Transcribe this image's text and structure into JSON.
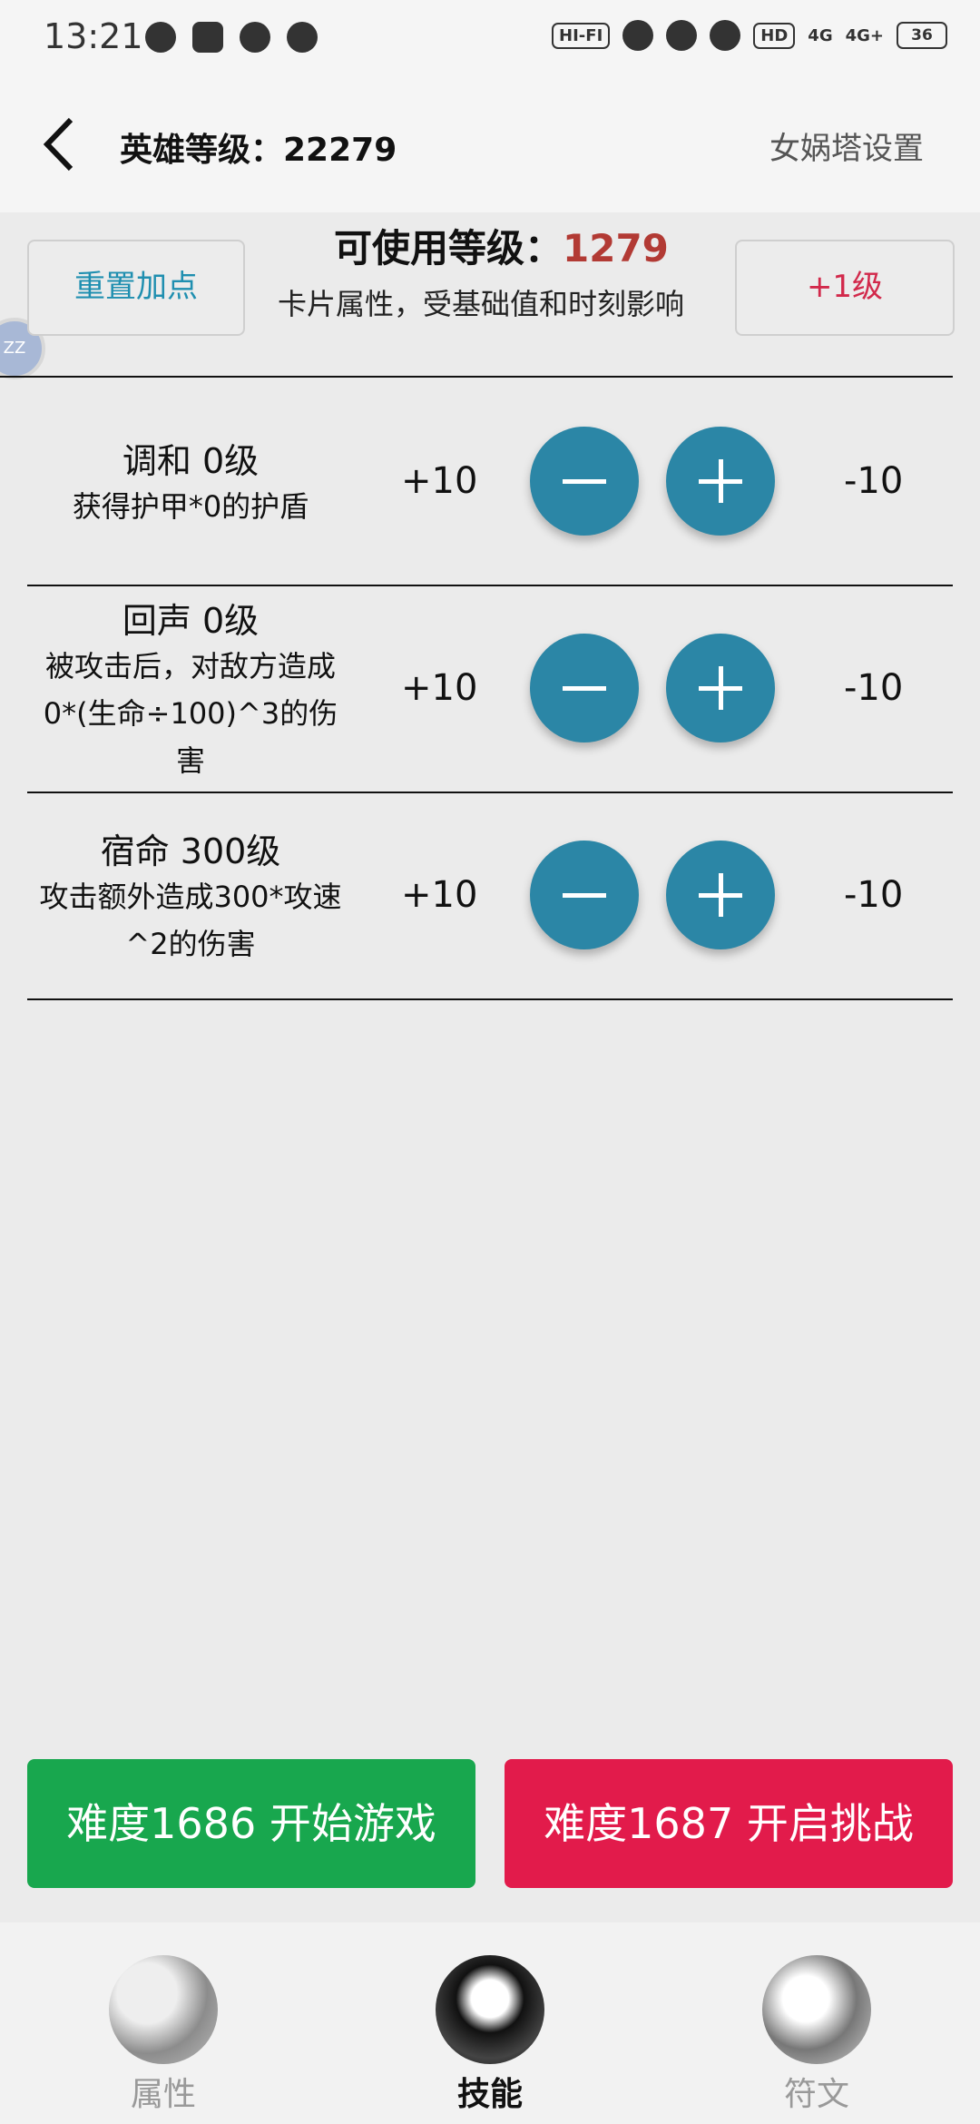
{
  "status_bar": {
    "time": "13:21",
    "hifi": "HI-FI",
    "hd": "HD",
    "net1": "4G",
    "net2": "4G+",
    "battery": "36"
  },
  "header": {
    "title": "英雄等级：22279",
    "settings": "女娲塔设置"
  },
  "top": {
    "reset_label": "重置加点",
    "avail_label": "可使用等级：",
    "avail_value": "1279",
    "description": "卡片属性，受基础值和时刻影响",
    "plus_level_label": "+1级"
  },
  "float_bubble": "ZZ",
  "skills": [
    {
      "name": "调和 0级",
      "desc": "获得护甲*0的护盾",
      "inc": "+10",
      "dec": "-10"
    },
    {
      "name": "回声 0级",
      "desc": "被攻击后，对敌方造成0*(生命÷100)^3的伤害",
      "inc": "+10",
      "dec": "-10"
    },
    {
      "name": "宿命 300级",
      "desc": "攻击额外造成300*攻速^2的伤害",
      "inc": "+10",
      "dec": "-10"
    }
  ],
  "actions": {
    "start": "难度1686 开始游戏",
    "challenge": "难度1687 开启挑战"
  },
  "nav": {
    "items": [
      {
        "label": "属性",
        "icon": "yin-yang-icon"
      },
      {
        "label": "技能",
        "icon": "yin-yang-wave-icon"
      },
      {
        "label": "符文",
        "icon": "yin-yang-cloud-icon"
      }
    ]
  },
  "colors": {
    "accent_blue": "#2b86a6",
    "start_green": "#18a74e",
    "challenge_red": "#e21b4b",
    "avail_red": "#b23a34"
  }
}
